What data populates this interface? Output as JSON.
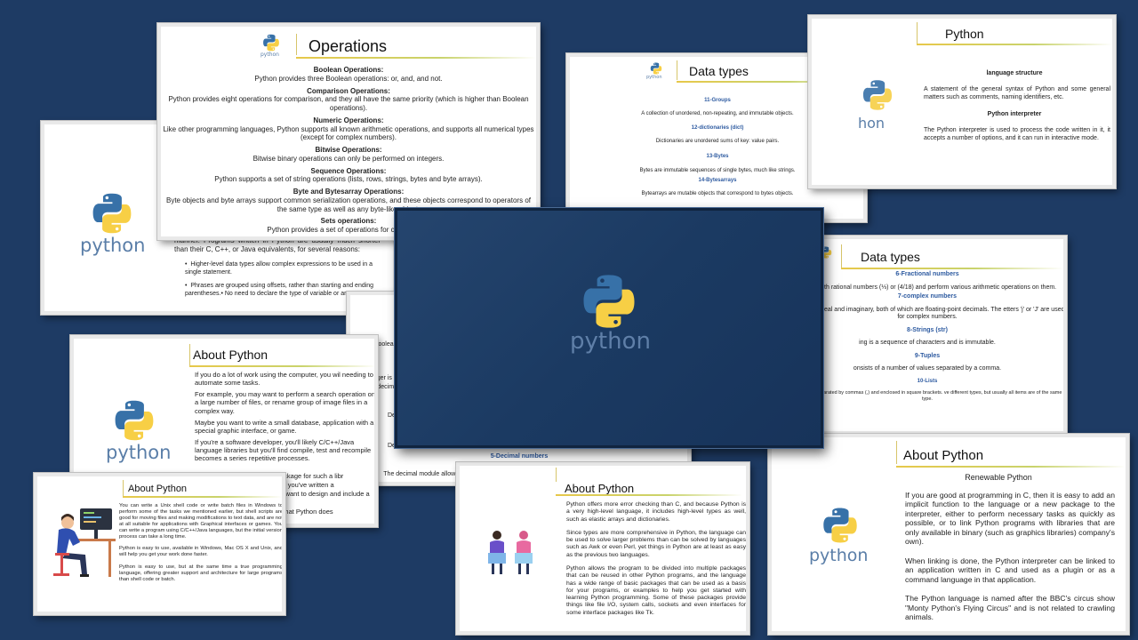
{
  "logo_word": "python",
  "colors": {
    "background": "#1e3b64",
    "python_blue": "#3771a8",
    "python_yellow": "#f7cf45"
  },
  "operations": {
    "title": "Operations",
    "sections": [
      {
        "head": "Boolean Operations:",
        "body": "Python provides three Boolean operations: or, and, and not."
      },
      {
        "head": "Comparison Operations:",
        "body": "Python provides eight operations for comparison, and they all have the same priority (which is higher than Boolean operations)."
      },
      {
        "head": "Numeric Operations:",
        "body": "Like other programming languages, Python supports all known arithmetic operations, and supports all numerical types (except for complex numbers)."
      },
      {
        "head": "Bitwise Operations:",
        "body": "Bitwise binary operations can only be performed on integers."
      },
      {
        "head": "Sequence Operations:",
        "body": "Python supports a set of string operations (lists, rows, strings, bytes and byte arrays)."
      },
      {
        "head": "Byte and Bytesarray Operations:",
        "body": "Byte objects and byte arrays support common serialization operations, and these objects correspond to operators of the same type as well as any byte-like object."
      },
      {
        "head": "Sets operations:",
        "body": "Python provides a set of operations for collections a"
      }
    ]
  },
  "left_python": {
    "intro": "manner. Programs written in Python are usually much shorter than their C, C++, or Java equivalents, for several reasons:",
    "bullets": [
      "Higher-level data types allow complex expressions to be used in a single statement.",
      "Phrases are grouped using offsets, rather than starting and ending parentheses.• No need to declare the type of variable or argument."
    ]
  },
  "datatypes1": {
    "title": "Data types",
    "items": [
      {
        "head": "11-Groups",
        "body": "A collection of unordered, non-repeating, and immutable objects."
      },
      {
        "head": "12-dictionaries (dict)",
        "body": "Dictionaries are unordered sums of key: value pairs."
      },
      {
        "head": "13-Bytes",
        "body": "Bytes are immutable sequences of single bytes, much like strings."
      },
      {
        "head": "14-Bytesarrays",
        "body": "Bytearrays are mutable objects that correspond to bytes objects."
      }
    ]
  },
  "python_slide": {
    "title": "Python",
    "head1": "language structure",
    "body1": "A statement of the general syntax of Python and some general matters such as comments, naming identifiers, etc.",
    "head2": "Python interpreter",
    "body2": "The Python interpreter is used to process the code written in it, it accepts a number of options, and it can run in interactive mode."
  },
  "datatypes2": {
    "title": "Data types",
    "items": [
      {
        "head": "6-Fractional numbers",
        "body": "o work with rational numbers (⅓) or (4/18) and perform various arithmetic operations on them."
      },
      {
        "head": "7-complex numbers",
        "body": "f two parts, real and imaginary, both of which are floating-point decimals. The etters 'j' or 'J' are used for complex numbers."
      },
      {
        "head": "8-Strings (str)",
        "body": "ing is a sequence of characters and is immutable."
      },
      {
        "head": "9-Tuples",
        "body": "onsists of a number of values separated by a comma."
      },
      {
        "head": "10-Lists",
        "body": "elements) separated by commas (,) and enclosed in square brackets. ve different types, but usually all items are of the same type."
      }
    ]
  },
  "numbers_slide": {
    "t1": "The two Boolea",
    "t2": "An integer is a",
    "t3": "decimal (decim",
    "t4": "De",
    "t5": "De",
    "head": "5-Decimal numbers",
    "body": "The decimal module allows quick calculations to decimal numbers while ensuring correct rounding."
  },
  "about1": {
    "title": "About Python",
    "paras": [
      "If you do a lot of work using the computer, you wil needing to automate some tasks.",
      "For example, you may want to perform a search operation on a large number of files, or rename group of image files in a complex way.",
      "Maybe you want to write a small database, application with a special graphic interface, or game.",
      "If you're a software developer, you'll likely C/C++/Java language libraries but you'll find compile, test and recompile becomes a series repetitive processes."
    ],
    "frag1": "ackage for such a libr",
    "frag2": "or you've written a",
    "frag3": "'t want to design and include a",
    "frag4": "n.",
    "frag5": "what Python does"
  },
  "about2": {
    "title": "About Python",
    "paras": [
      "You can write a Unix shell code or write batch files in Windows to perform some of the tasks we mentioned earlier, but shell scripts are good for moving files and making modifications to text data, and are not at all suitable for applications with Graphical interfaces or games. You can write a program using C/C++/Java languages, but the initial version process can take a long time.",
      "Python is easy to use, available in Windows, Mac OS X and Unix, and will help you get your work done faster.",
      "Python is easy to use, but at the same time a true programming language, offering greater support and architecture for large programs than shell code or batch."
    ]
  },
  "about3": {
    "title": "About Python",
    "paras": [
      "Python offers more error checking than C, and because Python is a very high-level language, it includes high-level types as well, such as elastic arrays and dictionaries.",
      "Since types are more comprehensive in Python, the language can be used to solve larger problems than can be solved by languages such as Awk or even Perl, yet things in Python are at least as easy as the previous two languages.",
      "Python allows the program to be divided into multiple packages that can be reused in other Python programs, and the language has a wide range of basic packages that can be used as a basis for your programs, or examples to help you get started with learning Python programming. Some of these packages provide things like file I/O, system calls, sockets and even interfaces for some interface packages like Tk."
    ]
  },
  "about4": {
    "title": "About Python",
    "subtitle": "Renewable Python",
    "paras": [
      "If you are good at programming in C, then it is easy to add an implicit function to the language or a new package to the interpreter, either to perform necessary tasks as quickly as possible, or to link Python programs with libraries that are only available in binary (such as graphics libraries) company's own).",
      "When linking is done, the Python interpreter can be linked to an application written in C and used as a plugin or as a command language in that application.",
      "The Python language is named after the BBC's circus show \"Monty Python's Flying Circus\" and is not related to crawling animals."
    ]
  }
}
